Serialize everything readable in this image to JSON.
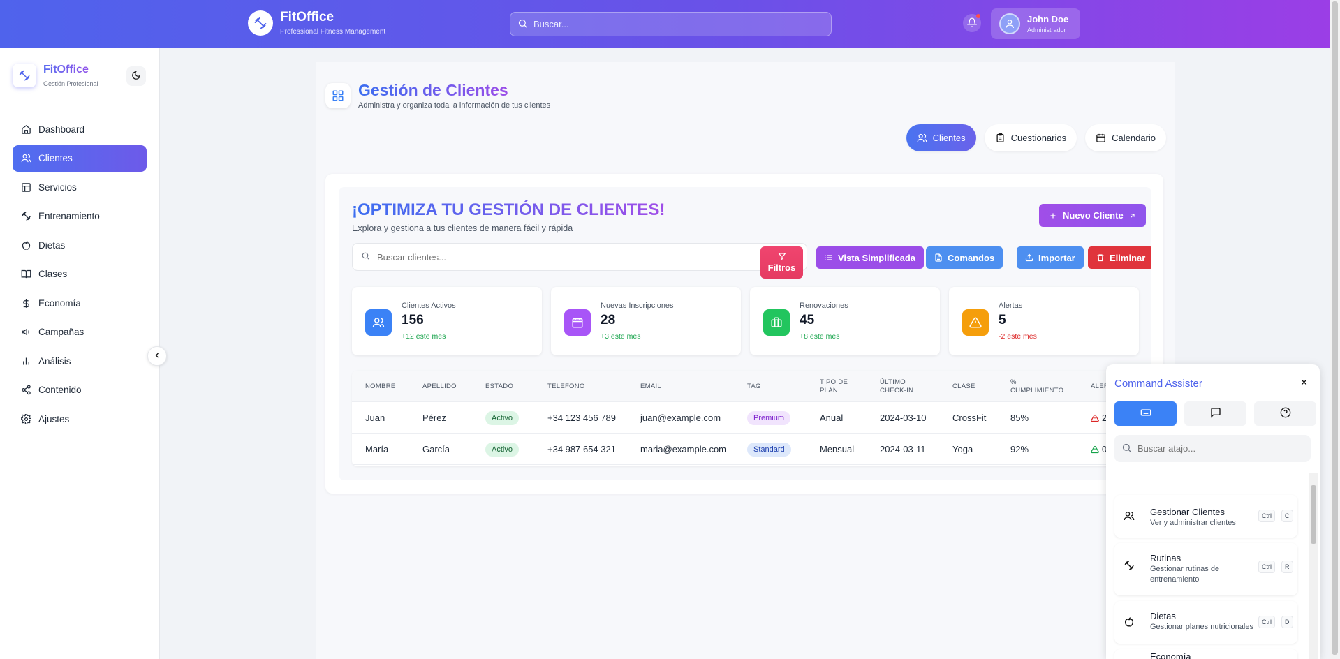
{
  "app": {
    "name": "FitOffice",
    "tagline": "Professional Fitness Management",
    "sidebar_tagline": "Gestión Profesional"
  },
  "topbar": {
    "search_placeholder": "Buscar...",
    "user_name": "John Doe",
    "user_role": "Administrador"
  },
  "sidebar": {
    "items": [
      {
        "label": "Dashboard",
        "icon": "home-icon"
      },
      {
        "label": "Clientes",
        "icon": "users-icon"
      },
      {
        "label": "Servicios",
        "icon": "layout-icon"
      },
      {
        "label": "Entrenamiento",
        "icon": "dumbbell-icon"
      },
      {
        "label": "Dietas",
        "icon": "apple-icon"
      },
      {
        "label": "Clases",
        "icon": "book-icon"
      },
      {
        "label": "Economía",
        "icon": "dollar-icon"
      },
      {
        "label": "Campañas",
        "icon": "megaphone-icon"
      },
      {
        "label": "Análisis",
        "icon": "bar-chart-icon"
      },
      {
        "label": "Contenido",
        "icon": "share-icon"
      },
      {
        "label": "Ajustes",
        "icon": "gear-icon"
      }
    ]
  },
  "page": {
    "title": "Gestión de Clientes",
    "subtitle": "Administra y organiza toda la información de tus clientes",
    "tabs": [
      {
        "label": "Clientes",
        "icon": "users-icon"
      },
      {
        "label": "Cuestionarios",
        "icon": "clipboard-icon"
      },
      {
        "label": "Calendario",
        "icon": "calendar-icon"
      }
    ]
  },
  "hero": {
    "title": "¡OPTIMIZA TU GESTIÓN DE CLIENTES!",
    "subtitle": "Explora y gestiona a tus clientes de manera fácil y rápida",
    "new_button": "Nuevo Cliente",
    "search_placeholder": "Buscar clientes...",
    "filters_button": "Filtros",
    "actions": {
      "vista": "Vista Simplificada",
      "comandos": "Comandos",
      "importar": "Importar",
      "eliminar": "Eliminar"
    }
  },
  "stats": [
    {
      "label": "Clientes Activos",
      "value": "156",
      "trend": "+12 este mes",
      "color": "#3b82f6"
    },
    {
      "label": "Nuevas Inscripciones",
      "value": "28",
      "trend": "+3 este mes",
      "color": "#a855f7"
    },
    {
      "label": "Renovaciones",
      "value": "45",
      "trend": "+8 este mes",
      "color": "#22c55e"
    },
    {
      "label": "Alertas",
      "value": "5",
      "trend": "-2 este mes",
      "color": "#f59e0b"
    }
  ],
  "table": {
    "headers": [
      "NOMBRE",
      "APELLIDO",
      "ESTADO",
      "TELÉFONO",
      "EMAIL",
      "TAG",
      "TIPO DE PLAN",
      "ÚLTIMO CHECK-IN",
      "CLASE",
      "% CUMPLIMIENTO",
      "ALERTAS"
    ],
    "headers_display": [
      "NOMBRE",
      "APELLIDO",
      "ESTADO",
      "TELÉFONO",
      "EMAIL",
      "TAG",
      "TIPO DE\nPLAN",
      "ÚLTIMO\nCHECK-IN",
      "CLASE",
      "%\nCUMPLIMIENTO",
      "ALER"
    ],
    "rows": [
      {
        "nombre": "Juan",
        "apellido": "Pérez",
        "estado": "Activo",
        "telefono": "+34 123 456 789",
        "email": "juan@example.com",
        "tag": "Premium",
        "plan": "Anual",
        "checkin": "2024-03-10",
        "clase": "CrossFit",
        "cumplimiento": "85%",
        "alertas": "2"
      },
      {
        "nombre": "María",
        "apellido": "García",
        "estado": "Activo",
        "telefono": "+34 987 654 321",
        "email": "maria@example.com",
        "tag": "Standard",
        "plan": "Mensual",
        "checkin": "2024-03-11",
        "clase": "Yoga",
        "cumplimiento": "92%",
        "alertas": "0"
      }
    ]
  },
  "command_assister": {
    "title": "Command Assister",
    "search_placeholder": "Buscar atajo...",
    "tabs": [
      "keyboard-icon",
      "message-icon",
      "help-icon"
    ],
    "items": [
      {
        "title": "Gestionar Clientes",
        "desc": "Ver y administrar clientes",
        "mod": "Ctrl",
        "key": "C"
      },
      {
        "title": "Rutinas",
        "desc": "Gestionar rutinas de entrenamiento",
        "mod": "Ctrl",
        "key": "R"
      },
      {
        "title": "Dietas",
        "desc": "Gestionar planes nutricionales",
        "mod": "Ctrl",
        "key": "D"
      },
      {
        "title": "Economía",
        "desc": "",
        "mod": "",
        "key": ""
      }
    ]
  }
}
